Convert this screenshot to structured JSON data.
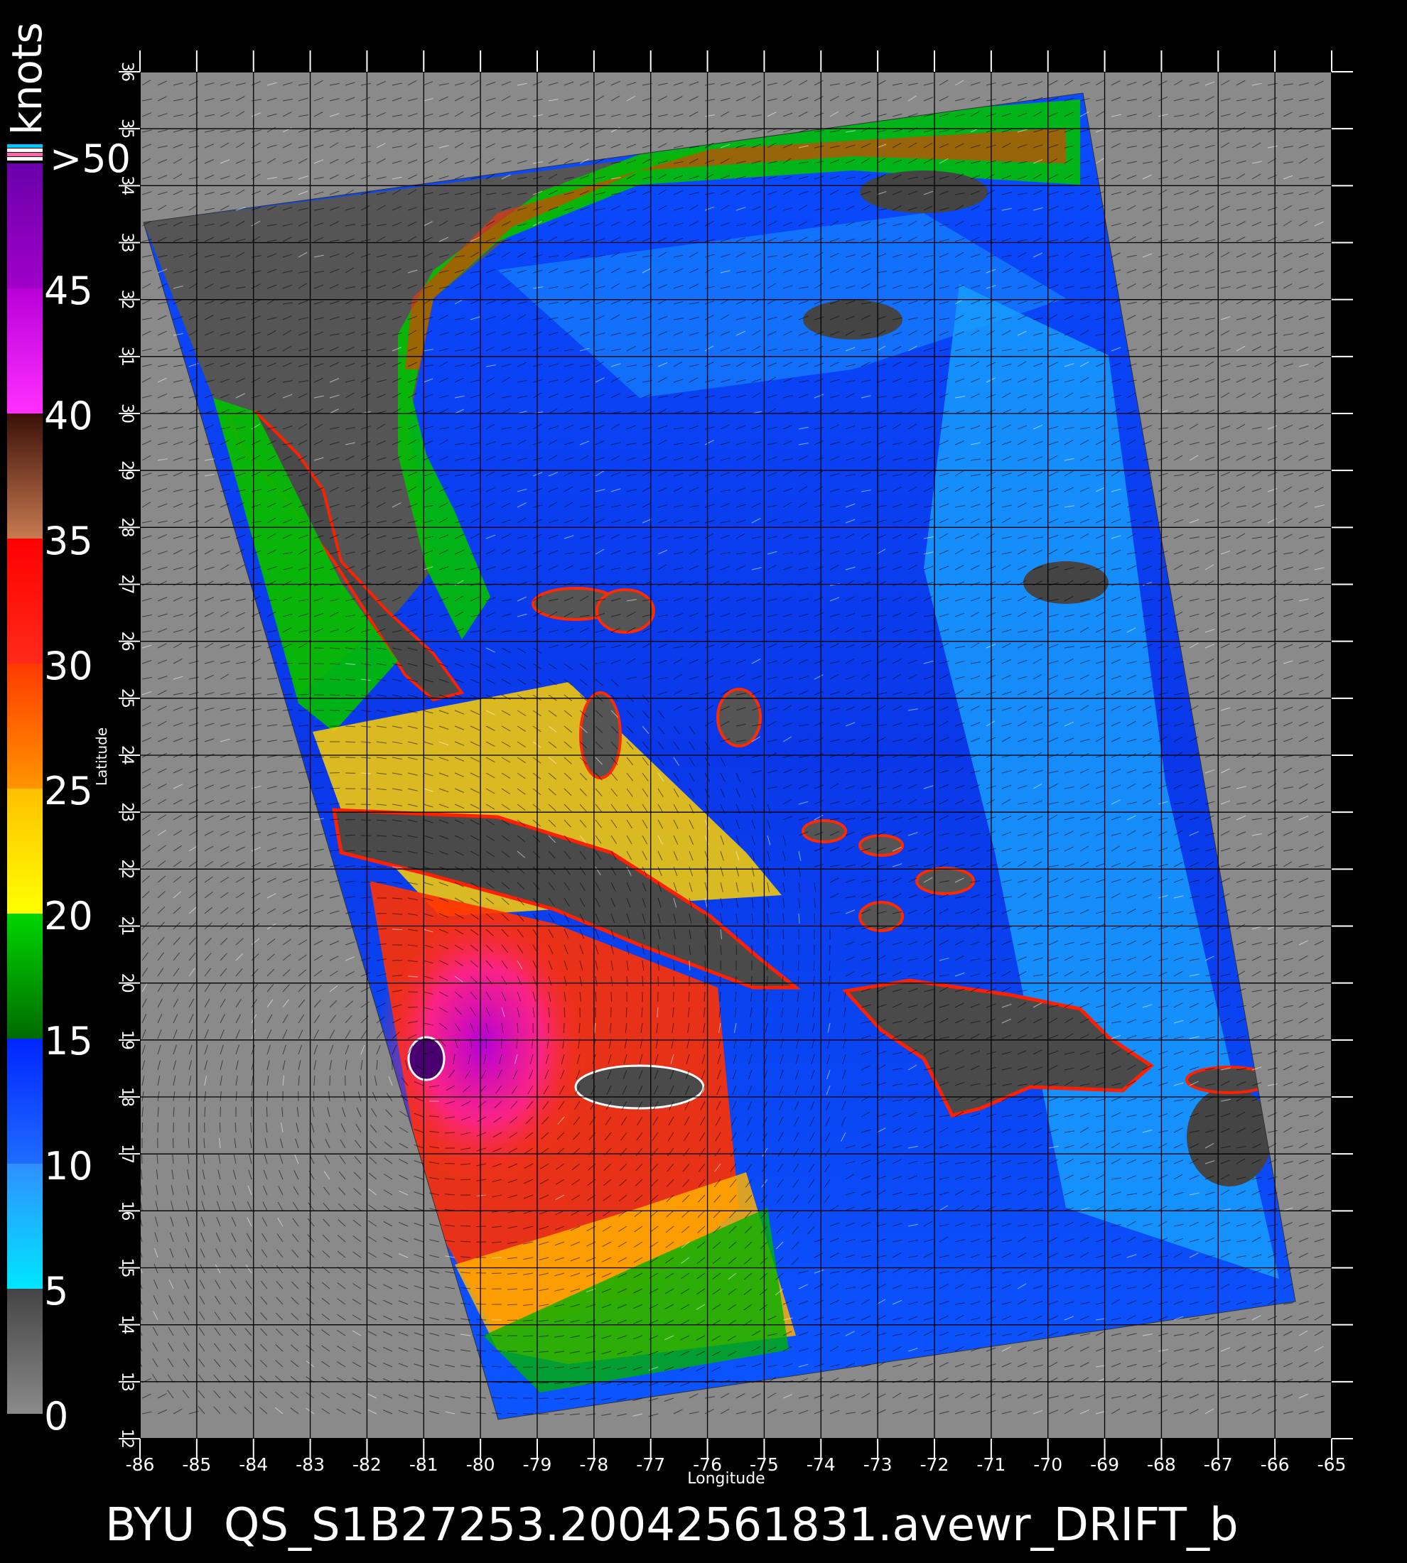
{
  "colorbar": {
    "units": "knots",
    "top_label": ">50",
    "labels": [
      "0",
      "5",
      "10",
      "15",
      "20",
      "25",
      "30",
      "35",
      "40",
      "45"
    ],
    "bands": [
      {
        "from": 0,
        "to": 5,
        "colors": [
          "#8a8a8a",
          "#444444"
        ]
      },
      {
        "from": 5,
        "to": 10,
        "colors": [
          "#00e6ff",
          "#2f8fff"
        ]
      },
      {
        "from": 10,
        "to": 15,
        "colors": [
          "#1f6cff",
          "#0025ff"
        ]
      },
      {
        "from": 15,
        "to": 20,
        "colors": [
          "#006a00",
          "#00d600"
        ]
      },
      {
        "from": 20,
        "to": 25,
        "colors": [
          "#ffff00",
          "#ffc000"
        ]
      },
      {
        "from": 25,
        "to": 30,
        "colors": [
          "#ff9500",
          "#ff3a00"
        ]
      },
      {
        "from": 30,
        "to": 35,
        "colors": [
          "#ff2a1a",
          "#ff0000"
        ]
      },
      {
        "from": 35,
        "to": 40,
        "colors": [
          "#c87a50",
          "#3a1008"
        ]
      },
      {
        "from": 40,
        "to": 45,
        "colors": [
          "#ff30ff",
          "#b800d8"
        ]
      },
      {
        "from": 45,
        "to": 50,
        "colors": [
          "#a000c8",
          "#6a00aa"
        ]
      }
    ],
    "top_stripes": [
      "#00c8ff",
      "#ffffff",
      "#ff66aa",
      "#ffffff"
    ]
  },
  "map": {
    "x_axis_label": "Longitude",
    "y_axis_label": "Latitude",
    "lon_range": [
      -86,
      -65
    ],
    "lat_range": [
      12,
      36
    ],
    "lon_ticks": [
      "-86",
      "-85",
      "-84",
      "-83",
      "-82",
      "-81",
      "-80",
      "-79",
      "-78",
      "-77",
      "-76",
      "-75",
      "-74",
      "-73",
      "-72",
      "-71",
      "-70",
      "-69",
      "-68",
      "-67",
      "-66",
      "-65"
    ],
    "lat_ticks": [
      "12",
      "13",
      "14",
      "15",
      "16",
      "17",
      "18",
      "19",
      "20",
      "21",
      "22",
      "23",
      "24",
      "25",
      "26",
      "27",
      "28",
      "29",
      "30",
      "31",
      "32",
      "33",
      "34",
      "35",
      "36"
    ],
    "grid": true,
    "background_color": "#8a8a8a",
    "land_color": "#4a4a4a"
  },
  "footer": {
    "title": "BYU  QS_S1B27253.20042561831.avewr_DRIFT_b"
  }
}
